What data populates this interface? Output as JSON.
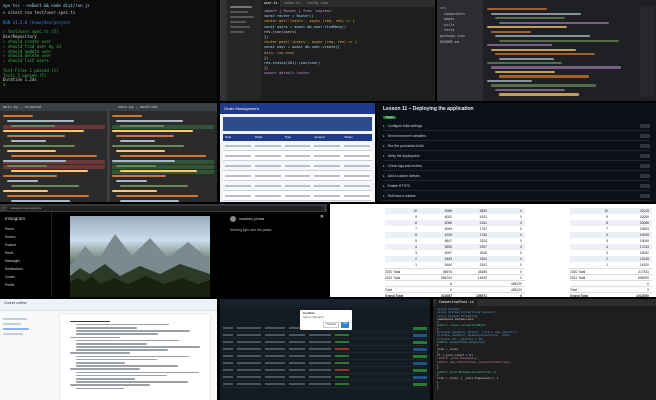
{
  "colors": {
    "green": "#3fb950",
    "blue": "#3b82f6",
    "red": "#e5534b",
    "yellow": "#e3b341",
    "purple": "#c792ea",
    "orange": "#f0883e"
  },
  "t1": {
    "command": "npx tsc --noEmit && node dist/run.js",
    "lines": [
      "> vitest run test/user.spec.ts",
      "",
      " RUN  v1.2.0  /home/dev/project",
      "",
      " ✓ test/user.spec.ts (5)",
      "   UserRepository",
      "     ✓ should create user",
      "     ✓ should find user by id",
      "     ✓ should update user",
      "     ✓ should delete user",
      "     ✓ should list users",
      "",
      " Test Files  1 passed (1)",
      "      Tests  5 passed (5)",
      "   Duration  1.24s"
    ],
    "prompt": "$"
  },
  "t2": {
    "tabs": [
      "user.ts",
      "index.ts",
      "config.json"
    ],
    "lines": [
      "import { Router } from 'express'",
      "const router = Router()",
      "",
      "router.get('/users', async (req, res) => {",
      "  const users = await db.user.findMany()",
      "  res.json(users)",
      "})",
      "",
      "router.post('/users', async (req, res) => {",
      "  const user = await db.user.create({",
      "    data: req.body",
      "  })",
      "  res.status(201).json(user)",
      "})",
      "",
      "export default router"
    ]
  },
  "t3": {
    "tree": [
      "src",
      "components",
      "pages",
      "utils",
      "tests",
      "package.json",
      "README.md"
    ]
  },
  "t4": {
    "header_left": "main.py — original",
    "header_right": "main.py — modified"
  },
  "t5": {
    "title": "Order Management",
    "columns": [
      "Date",
      "Order",
      "Type",
      "Amount",
      "Status"
    ]
  },
  "t6": {
    "title": "Lesson 11 – Deploying the application",
    "badge": "Open",
    "items": [
      "Configure build settings",
      "Set environment variables",
      "Run the production build",
      "Verify the deployment",
      "Check logs and metrics",
      "Add a custom domain",
      "Enable HTTPS",
      "Roll back a release"
    ]
  },
  "t7": {
    "url": "instagram.com/p/alpine",
    "logo": "Instagram",
    "nav": [
      "Home",
      "Search",
      "Explore",
      "Reels",
      "Messages",
      "Notifications",
      "Create",
      "Profile"
    ],
    "username": "mountain_photos",
    "caption": "Morning light over the peaks"
  },
  "t8": {
    "left": [
      [
        "10",
        "5066",
        "3653",
        "0"
      ],
      [
        "9",
        "6002",
        "5151",
        "0"
      ],
      [
        "8",
        "4066",
        "3161",
        "0"
      ],
      [
        "7",
        "5064",
        "1757",
        "0"
      ],
      [
        "6",
        "4025",
        "1760",
        "0"
      ],
      [
        "5",
        "5647",
        "3324",
        "0"
      ],
      [
        "4",
        "5506",
        "2907",
        "0"
      ],
      [
        "3",
        "5097",
        "2626",
        "0"
      ],
      [
        "2",
        "5463",
        "3304",
        "0"
      ],
      [
        "1",
        "5464",
        "3161",
        "0"
      ]
    ],
    "left_totals": [
      [
        "2020 Total",
        "55976",
        "34685",
        "0"
      ],
      [
        "2021 Total",
        "556704",
        "14692",
        "0"
      ],
      [
        "",
        "6",
        "",
        "485120"
      ],
      [
        "Total",
        "6",
        "",
        "485120"
      ],
      [
        "Grand Total",
        "214087",
        "155971",
        "0"
      ]
    ],
    "right": [
      [
        "10",
        "20016"
      ],
      [
        "9",
        "20050"
      ],
      [
        "8",
        "20066"
      ],
      [
        "7",
        "19604"
      ],
      [
        "6",
        "19069"
      ],
      [
        "5",
        "19049"
      ],
      [
        "4",
        "17033"
      ],
      [
        "3",
        "16062"
      ],
      [
        "2",
        "15045"
      ],
      [
        "1",
        "14920"
      ]
    ],
    "right_totals": [
      [
        "2020 Total",
        "217511"
      ],
      [
        "2021 Total",
        "695000"
      ],
      [
        "",
        "0"
      ],
      [
        "Total",
        "0"
      ],
      [
        "Grand Total",
        "1012000"
      ]
    ]
  },
  "t9": {
    "doc_title": "Course outline"
  },
  "t10": {
    "dialog_title": "Confirm",
    "dialog_text": "Apply changes?",
    "ok": "OK",
    "cancel": "Cancel"
  },
  "t11": {
    "tab": "ConnectionPool.cs",
    "lines": [
      "using System;",
      "using System.Collections.Generic;",
      "using System.Threading;",
      "",
      "namespace DataAccess",
      "{",
      "  public class ConnectionPool",
      "  {",
      "    private readonly object _lock = new object();",
      "    private readonly Queue<Connection> _pool;",
      "    private int _maxSize = 10;",
      "",
      "    public Connection Acquire()",
      "    {",
      "      lock (_lock)",
      "      {",
      "        if (_pool.Count > 0)",
      "          return _pool.Dequeue();",
      "        return new Connection(_connectionString);",
      "      }",
      "    }",
      "",
      "    public void Release(Connection c)",
      "    {",
      "      lock (_lock) { _pool.Enqueue(c); }",
      "    }",
      "  }",
      "}"
    ]
  }
}
